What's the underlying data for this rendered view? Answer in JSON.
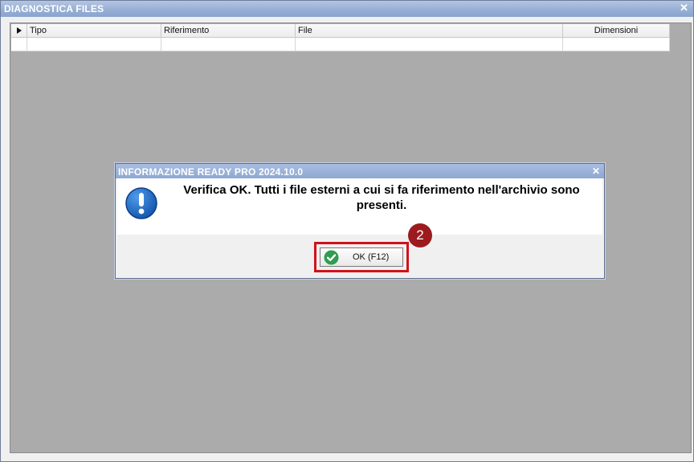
{
  "window": {
    "title": "DIAGNOSTICA FILES",
    "close_glyph": "✕"
  },
  "grid": {
    "columns": [
      "Tipo",
      "Riferimento",
      "File",
      "Dimensioni"
    ],
    "rows": [
      [
        "",
        "",
        "",
        ""
      ]
    ]
  },
  "dialog": {
    "title": "INFORMAZIONE READY PRO 2024.10.0",
    "close_glyph": "✕",
    "icon": "exclamation-info-icon",
    "message": "Verifica OK. Tutti i file esterni a cui si fa riferimento nell'archivio sono presenti.",
    "ok_label": "OK (F12)",
    "ok_icon": "green-check-icon"
  },
  "annotation": {
    "step_number": "2",
    "highlight_color": "#d0121b",
    "badge_color": "#9c1b1f"
  },
  "colors": {
    "title_gradient_top": "#b3c5e3",
    "title_gradient_bottom": "#8aa4cf",
    "workspace": "#ababab",
    "icon_blue": "#1565c0",
    "check_green": "#2e9d4f"
  }
}
